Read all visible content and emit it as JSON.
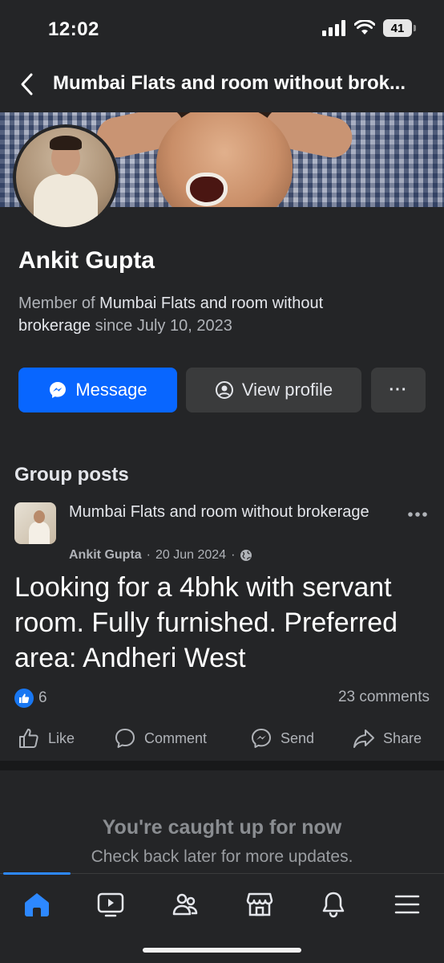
{
  "status_bar": {
    "time": "12:02",
    "battery": "41"
  },
  "header": {
    "title": "Mumbai Flats and room without brok..."
  },
  "profile": {
    "name": "Ankit Gupta",
    "member_prefix": "Member of ",
    "group_name": "Mumbai Flats and room without brokerage",
    "since_text": " since July 10, 2023"
  },
  "actions": {
    "message_label": "Message",
    "view_profile_label": "View profile",
    "more_label": "···"
  },
  "group_posts": {
    "title": "Group posts",
    "post": {
      "group": "Mumbai Flats and room without brokerage",
      "author": "Ankit Gupta",
      "date": "20 Jun 2024",
      "separator": "·",
      "text": "Looking for a 4bhk with servant room. Fully furnished. Preferred area: Andheri West",
      "reaction_count": "6",
      "comments": "23 comments"
    },
    "post_actions": {
      "like": "Like",
      "comment": "Comment",
      "send": "Send",
      "share": "Share"
    }
  },
  "feed_end": {
    "title": "You're caught up for now",
    "subtitle": "Check back later for more updates."
  },
  "tabbar": {
    "tabs": [
      "home-icon",
      "video-icon",
      "groups-icon",
      "marketplace-icon",
      "notifications-icon",
      "menu-icon"
    ],
    "active": "home-icon",
    "active_color": "#2d88ff"
  },
  "colors": {
    "primary": "#0866ff",
    "background": "#242527",
    "secondary_button": "#3a3b3c"
  }
}
